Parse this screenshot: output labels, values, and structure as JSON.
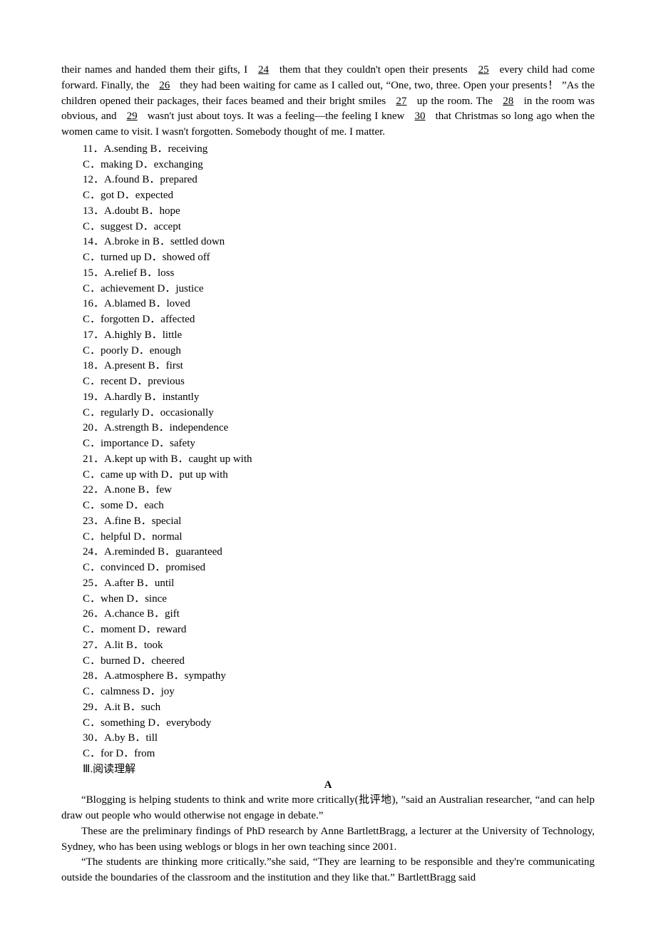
{
  "passage": {
    "p1": "their names and handed them their gifts, I ",
    "b24": "  24  ",
    "p2": " them that they couldn't open their presents ",
    "b25": "  25  ",
    "p3": " every child had come forward. Finally, the ",
    "b26": "  26  ",
    "p4": " they had been waiting for came as I called out, “One, two, three. Open your presents！ ”As the children opened their packages, their faces beamed and their bright smiles ",
    "b27": "  27  ",
    "p5": " up the room. The ",
    "b28": "  28  ",
    "p6": " in the room was obvious, and ",
    "b29": "  29  ",
    "p7": " wasn't just about toys. It was a feeling—the feeling I knew ",
    "b30": "  30  ",
    "p8": " that Christmas so long ago when the women came to visit. I wasn't forgotten. Somebody thought of me. I matter."
  },
  "questions": [
    {
      "n": "11",
      "r1": "A.sending   B．receiving",
      "r2": "C．making   D．exchanging"
    },
    {
      "n": "12",
      "r1": "A.found   B．prepared",
      "r2": "C．got   D．expected"
    },
    {
      "n": "13",
      "r1": "A.doubt   B．hope",
      "r2": "C．suggest   D．accept"
    },
    {
      "n": "14",
      "r1": "A.broke in    B．settled down",
      "r2": "C．turned up    D．showed off"
    },
    {
      "n": "15",
      "r1": "A.relief   B．loss",
      "r2": "C．achievement   D．justice"
    },
    {
      "n": "16",
      "r1": "A.blamed   B．loved",
      "r2": "C．forgotten   D．affected"
    },
    {
      "n": "17",
      "r1": "A.highly   B．little",
      "r2": "C．poorly   D．enough"
    },
    {
      "n": "18",
      "r1": "A.present   B．first",
      "r2": "C．recent   D．previous"
    },
    {
      "n": "19",
      "r1": "A.hardly   B．instantly",
      "r2": "C．regularly   D．occasionally"
    },
    {
      "n": "20",
      "r1": "A.strength   B．independence",
      "r2": "C．importance   D．safety"
    },
    {
      "n": "21",
      "r1": "A.kept up with    B．caught up with",
      "r2": "C．came up with    D．put up with"
    },
    {
      "n": "22",
      "r1": "A.none   B．few",
      "r2": "C．some   D．each"
    },
    {
      "n": "23",
      "r1": "A.fine   B．special",
      "r2": "C．helpful   D．normal"
    },
    {
      "n": "24",
      "r1": "A.reminded   B．guaranteed",
      "r2": "C．convinced   D．promised"
    },
    {
      "n": "25",
      "r1": "A.after   B．until",
      "r2": "C．when   D．since"
    },
    {
      "n": "26",
      "r1": "A.chance   B．gift",
      "r2": "C．moment   D．reward"
    },
    {
      "n": "27",
      "r1": "A.lit   B．took",
      "r2": "C．burned   D．cheered"
    },
    {
      "n": "28",
      "r1": "A.atmosphere   B．sympathy",
      "r2": "C．calmness   D．joy"
    },
    {
      "n": "29",
      "r1": "A.it   B．such",
      "r2": "C．something   D．everybody"
    },
    {
      "n": "30",
      "r1": "A.by   B．till",
      "r2": "C．for   D．from"
    }
  ],
  "sectionTitle": "Ⅲ.阅读理解",
  "sectionLetter": "A",
  "reading": {
    "p1": "“Blogging is helping students to think and write more critically(批评地),    ”said an Australian researcher, “and can help draw out people who would otherwise not engage in debate.”",
    "p2": "These are the preliminary findings of PhD research by Anne Bartlett­Bragg,    a lecturer at the University of Technology,   Sydney,   who has been using weblogs or blogs in her own teaching since 2001.",
    "p3": "“The students are thinking more critically.”she said,  “They are learning to be responsible and they're communicating outside the boundaries of the classroom and the institution and they like that.” Bartlett­Bragg said"
  }
}
